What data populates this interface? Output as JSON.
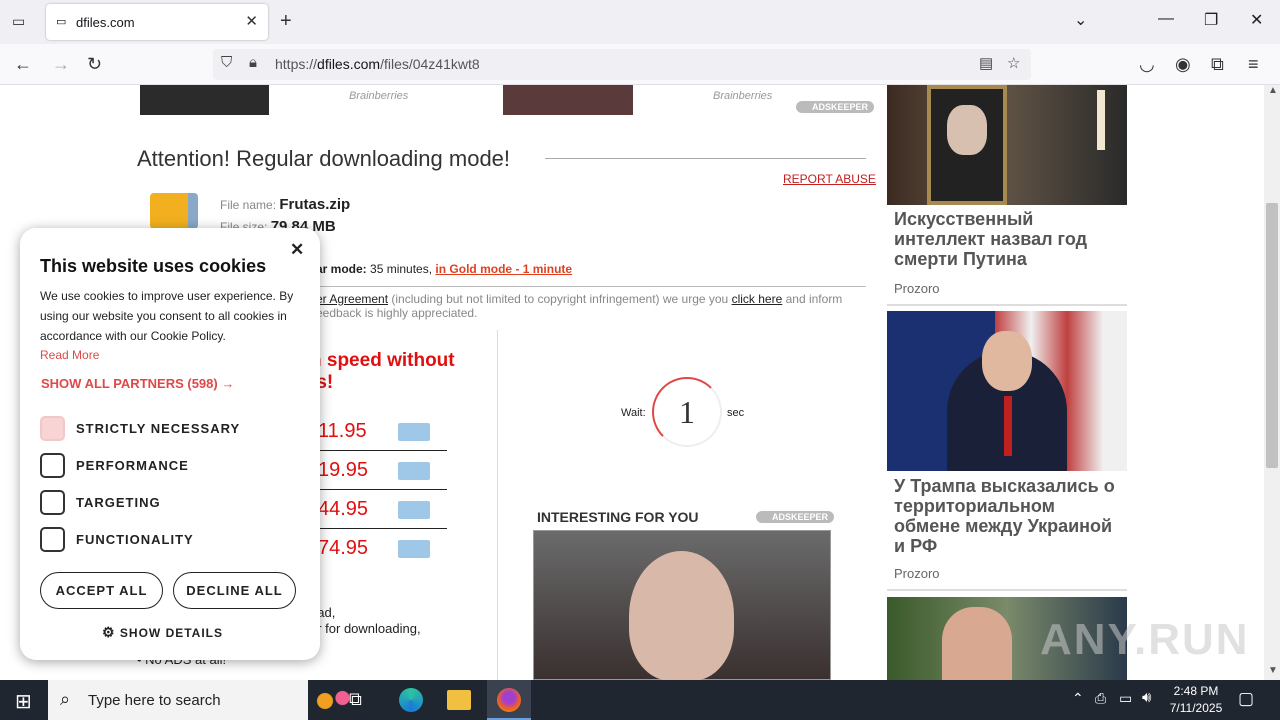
{
  "browser": {
    "tab_title": "dfiles.com",
    "url_prefix": "https://",
    "url_domain": "dfiles.com",
    "url_path": "/files/04z41kwt8"
  },
  "page": {
    "brainberries_1": "Brainberries",
    "brainberries_2": "Brainberries",
    "adskeeper_1": "ADSKEEPER",
    "heading": "Attention! Regular downloading mode!",
    "report_abuse": "REPORT ABUSE",
    "file_name_label": "File name:",
    "file_name_value": "Frutas.zip",
    "file_size_label": "File size:",
    "file_size_value": "79.84 MB",
    "mode_text_regular": "ar mode:",
    "mode_minutes": "35 minutes,",
    "mode_gold_link": "in Gold mode - 1 minute",
    "agreement_link": "er Agreement",
    "agreement_text": "(including but not limited to copyright infringement) we urge you",
    "click_here": "click here",
    "agreement_tail": "and inform",
    "feedback_text": "eedback is highly appreciated.",
    "promo_line1": "n speed without",
    "promo_line2": "ts!",
    "prices": [
      "11.95",
      "19.95",
      "44.95",
      "74.95"
    ],
    "wait_label": "Wait:",
    "wait_value": "1",
    "wait_unit": "sec",
    "interesting": "INTERESTING FOR YOU",
    "adskeeper_2": "ADSKEEPER",
    "bullet_1": "oad,",
    "bullet_2": "er for downloading,",
    "bullet_3": "No ADS at all!"
  },
  "news": [
    {
      "title": "Искусственный интеллект назвал год смерти Путина",
      "source": "Prozoro"
    },
    {
      "title": "У Трампа высказались о территориальном обмене между Украиной и РФ",
      "source": "Prozoro"
    }
  ],
  "cookie": {
    "title": "This website uses cookies",
    "body": "We use cookies to improve user experience. By using our website you consent to all cookies in accordance with our Cookie Policy.",
    "read_more": "Read More",
    "partners": "SHOW ALL PARTNERS (598) →",
    "options": [
      {
        "label": "STRICTLY NECESSARY",
        "checked": true
      },
      {
        "label": "PERFORMANCE",
        "checked": false
      },
      {
        "label": "TARGETING",
        "checked": false
      },
      {
        "label": "FUNCTIONALITY",
        "checked": false
      }
    ],
    "accept": "ACCEPT ALL",
    "decline": "DECLINE ALL",
    "details": "SHOW DETAILS",
    "close": "✕"
  },
  "taskbar": {
    "search_placeholder": "Type here to search",
    "time": "2:48 PM",
    "date": "7/11/2025"
  },
  "watermark": "ANY.RUN",
  "colors": {
    "accent_red": "#e01010",
    "link_red": "#e04848",
    "taskbar": "#1f2630"
  }
}
